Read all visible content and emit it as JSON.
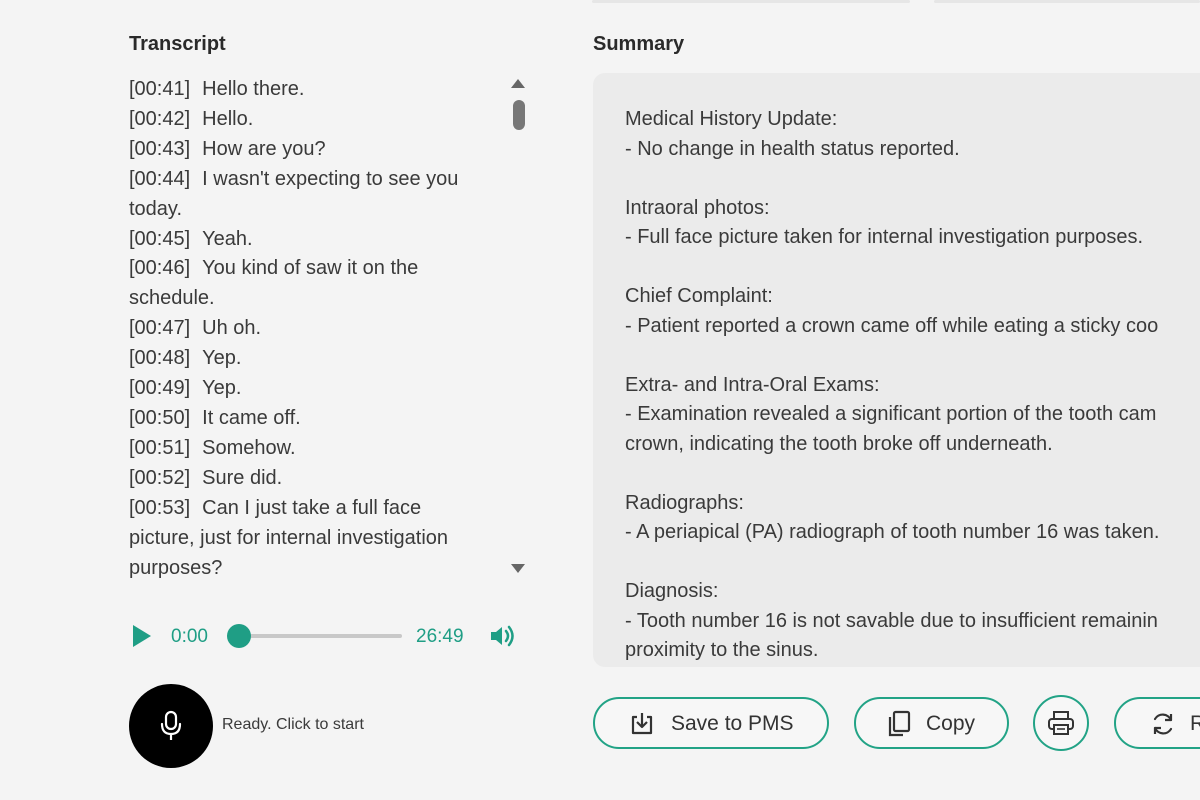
{
  "transcript": {
    "heading": "Transcript",
    "lines": [
      {
        "time": "[00:41]",
        "text": "Hello there."
      },
      {
        "time": "[00:42]",
        "text": "Hello."
      },
      {
        "time": "[00:43]",
        "text": "How are you?"
      },
      {
        "time": "[00:44]",
        "text": "I wasn't expecting to see you today."
      },
      {
        "time": "[00:45]",
        "text": "Yeah."
      },
      {
        "time": "[00:46]",
        "text": "You kind of saw it on the schedule."
      },
      {
        "time": "[00:47]",
        "text": "Uh oh."
      },
      {
        "time": "[00:48]",
        "text": "Yep."
      },
      {
        "time": "[00:49]",
        "text": "Yep."
      },
      {
        "time": "[00:50]",
        "text": "It came off."
      },
      {
        "time": "[00:51]",
        "text": "Somehow."
      },
      {
        "time": "[00:52]",
        "text": "Sure did."
      },
      {
        "time": "[00:53]",
        "text": "Can I just take a full face picture, just for internal investigation purposes?"
      }
    ]
  },
  "player": {
    "current_time": "0:00",
    "duration": "26:49",
    "progress": 0
  },
  "recorder": {
    "status": "Ready. Click to start"
  },
  "summary": {
    "heading": "Summary",
    "text": "Medical History Update:\n- No change in health status reported.\n\nIntraoral photos:\n- Full face picture taken for internal investigation purposes.\n\nChief Complaint:\n- Patient reported a crown came off while eating a sticky coo\n\nExtra- and Intra-Oral Exams:\n- Examination revealed a significant portion of the tooth cam\ncrown, indicating the tooth broke off underneath.\n\nRadiographs:\n- A periapical (PA) radiograph of tooth number 16 was taken.\n\nDiagnosis:\n- Tooth number 16 is not savable due to insufficient remainin\nproximity to the sinus."
  },
  "actions": {
    "save_label": "Save to PMS",
    "copy_label": "Copy",
    "refresh_label": "R"
  },
  "colors": {
    "accent": "#1f9e85",
    "button_border": "#22a386"
  }
}
